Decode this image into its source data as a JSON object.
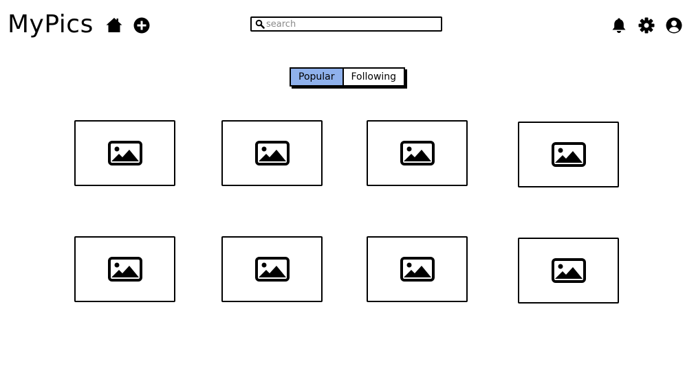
{
  "header": {
    "app_title": "MyPics",
    "icons": {
      "home": "home-icon",
      "add": "plus-circle-icon",
      "notifications": "bell-icon",
      "settings": "gear-icon",
      "profile": "user-circle-icon"
    }
  },
  "search": {
    "placeholder": "search",
    "value": ""
  },
  "tabs": [
    {
      "label": "Popular",
      "active": true
    },
    {
      "label": "Following",
      "active": false
    }
  ],
  "colors": {
    "active_tab": "#8fb1ec",
    "ink": "#000000",
    "placeholder": "#8a8a8a"
  },
  "photos": [
    {
      "icon": "image-icon"
    },
    {
      "icon": "image-icon"
    },
    {
      "icon": "image-icon"
    },
    {
      "icon": "image-icon"
    },
    {
      "icon": "image-icon"
    },
    {
      "icon": "image-icon"
    },
    {
      "icon": "image-icon"
    },
    {
      "icon": "image-icon"
    }
  ]
}
